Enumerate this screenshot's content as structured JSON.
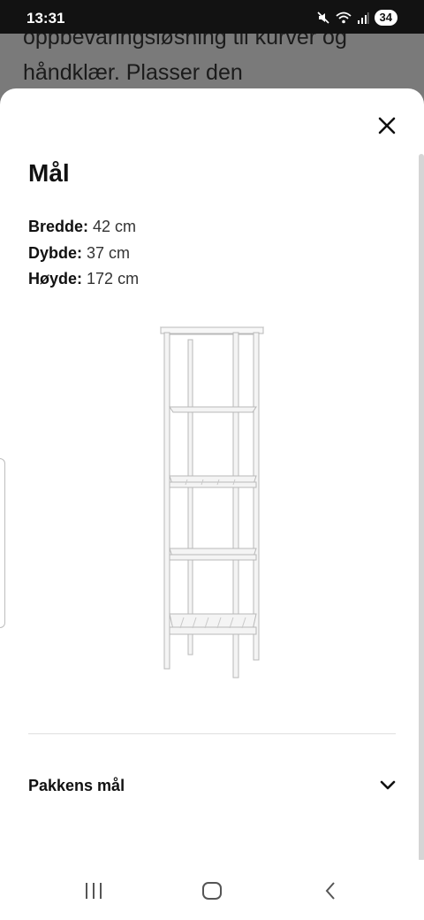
{
  "status_bar": {
    "time": "13:31",
    "battery": "34"
  },
  "background": {
    "description_text": "oppbevaringsløsning til kurver og håndklær. Plasser den"
  },
  "sheet": {
    "title": "Mål",
    "dimensions": [
      {
        "label": "Bredde:",
        "value": "42 cm"
      },
      {
        "label": "Dybde:",
        "value": "37 cm"
      },
      {
        "label": "Høyde:",
        "value": "172 cm"
      }
    ],
    "image_icon": "bathroom-shelf-unit-image",
    "package_section": {
      "label": "Pakkens mål",
      "icon": "chevron-down-icon"
    }
  },
  "colors": {
    "overlay": "#7a7a7a",
    "status_bar": "#121212",
    "text": "#111111"
  }
}
